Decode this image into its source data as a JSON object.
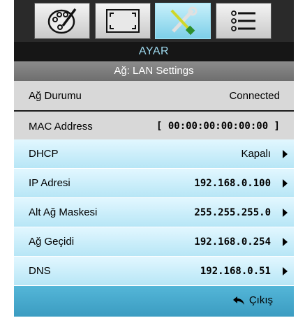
{
  "tabs": [
    {
      "icon": "palette-icon",
      "active": false
    },
    {
      "icon": "display-resize-icon",
      "active": false
    },
    {
      "icon": "tools-icon",
      "active": true
    },
    {
      "icon": "list-menu-icon",
      "active": false
    }
  ],
  "menu": {
    "title": "AYAR",
    "subtitle": "Ağ: LAN Settings"
  },
  "rows": [
    {
      "label": "Ağ Durumu",
      "value": "Connected"
    },
    {
      "label": "MAC Address",
      "value": "[ 00:00:00:00:00:00 ]"
    },
    {
      "label": "DHCP",
      "value": "Kapalı"
    },
    {
      "label": "IP Adresi",
      "value": "192.168.0.100"
    },
    {
      "label": "Alt Ağ Maskesi",
      "value": "255.255.255.0"
    },
    {
      "label": "Ağ Geçidi",
      "value": "192.168.0.254"
    },
    {
      "label": "DNS",
      "value": "192.168.0.51"
    }
  ],
  "footer": {
    "exit_label": "Çıkış",
    "exit_icon": "return-arrow-icon"
  },
  "colors": {
    "highlight": "#b7e6f6",
    "footer": "#3b9cc1",
    "header_text": "#9ed9ee"
  }
}
